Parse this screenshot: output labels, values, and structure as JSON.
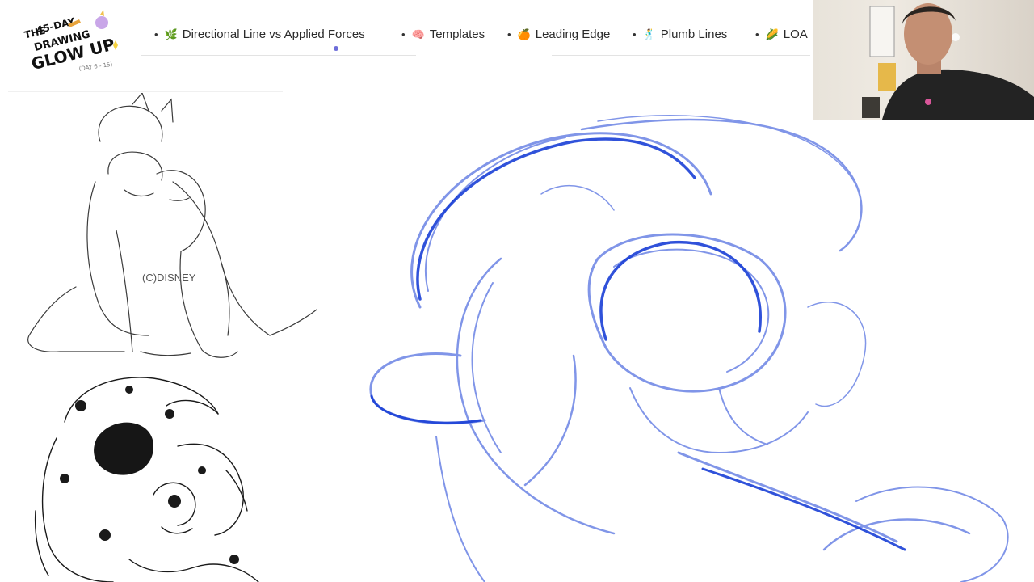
{
  "logo": {
    "line1": "THE",
    "line2": "45-DAY",
    "line3": "DRAWING",
    "line4": "GLOW UP",
    "subtitle": "(DAY 6 - 15)"
  },
  "nav": {
    "items": [
      {
        "emoji": "🌿",
        "label": "Directional Line vs Applied Forces"
      },
      {
        "emoji": "🧠",
        "label": "Templates"
      },
      {
        "emoji": "🍊",
        "label": "Leading Edge"
      },
      {
        "emoji": "🕺",
        "label": "Plumb Lines"
      },
      {
        "emoji": "🌽",
        "label": "LOA"
      }
    ],
    "bullet": "•"
  },
  "reference": {
    "watermark": "(C)DISNEY"
  },
  "colors": {
    "stroke_blue": "#1a3fd6",
    "sketch_black": "#1a1a1a",
    "nav_text": "#2b2b2b"
  }
}
